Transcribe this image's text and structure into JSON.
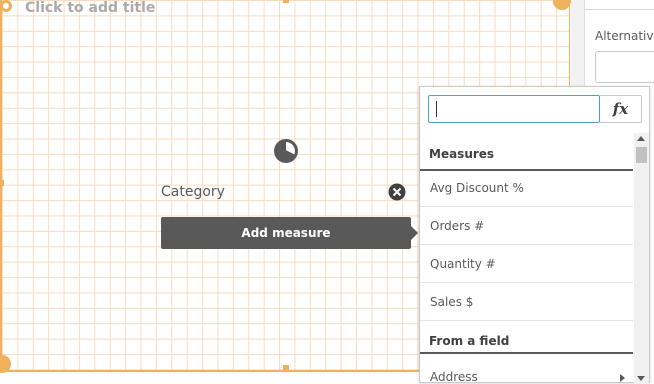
{
  "canvas": {
    "title_placeholder": "Click to add title",
    "category_label": "Category",
    "add_measure_label": "Add measure",
    "accent_color": "#f0b15c",
    "icons": [
      "chart-title-icon",
      "pie-chart-icon",
      "remove-dimension-icon"
    ]
  },
  "right_panel": {
    "alternative_label": "Alternative",
    "alternative_value": ""
  },
  "dropdown": {
    "search_value": "",
    "fx_label": "fx",
    "measures_header": "Measures",
    "measures": [
      {
        "label": "Avg Discount %"
      },
      {
        "label": "Orders #"
      },
      {
        "label": "Quantity #"
      },
      {
        "label": "Sales $"
      }
    ],
    "field_header": "From a field",
    "fields": [
      {
        "label": "Address"
      }
    ]
  }
}
